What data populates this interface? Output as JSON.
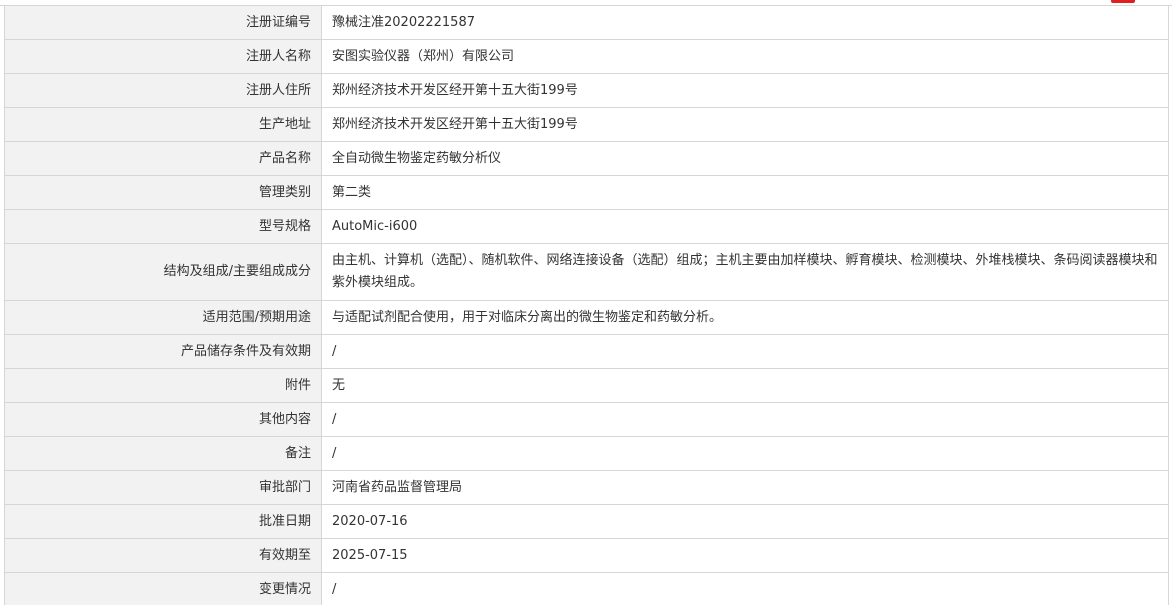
{
  "rows": [
    {
      "label": "注册证编号",
      "value": "豫械注准20202221587"
    },
    {
      "label": "注册人名称",
      "value": "安图实验仪器（郑州）有限公司"
    },
    {
      "label": "注册人住所",
      "value": "郑州经济技术开发区经开第十五大街199号"
    },
    {
      "label": "生产地址",
      "value": "郑州经济技术开发区经开第十五大街199号"
    },
    {
      "label": "产品名称",
      "value": "全自动微生物鉴定药敏分析仪"
    },
    {
      "label": "管理类别",
      "value": "第二类"
    },
    {
      "label": "型号规格",
      "value": "AutoMic-i600"
    },
    {
      "label": "结构及组成/主要组成成分",
      "value": "由主机、计算机（选配）、随机软件、网络连接设备（选配）组成；主机主要由加样模块、孵育模块、检测模块、外堆栈模块、条码阅读器模块和紫外模块组成。"
    },
    {
      "label": "适用范围/预期用途",
      "value": "与适配试剂配合使用，用于对临床分离出的微生物鉴定和药敏分析。"
    },
    {
      "label": "产品储存条件及有效期",
      "value": "/"
    },
    {
      "label": "附件",
      "value": "无"
    },
    {
      "label": "其他内容",
      "value": "/"
    },
    {
      "label": "备注",
      "value": "/"
    },
    {
      "label": "审批部门",
      "value": "河南省药品监督管理局"
    },
    {
      "label": "批准日期",
      "value": "2020-07-16"
    },
    {
      "label": "有效期至",
      "value": "2025-07-15"
    },
    {
      "label": "变更情况",
      "value": "/"
    }
  ]
}
